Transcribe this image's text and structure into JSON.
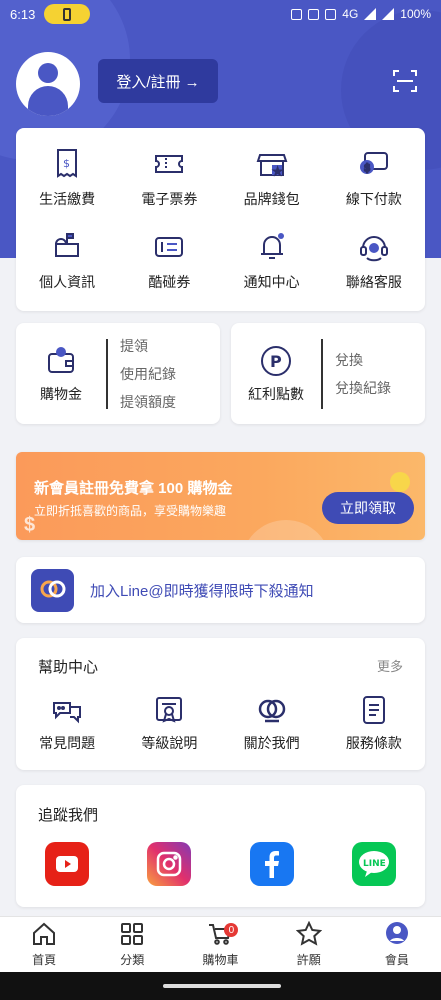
{
  "status": {
    "time": "6:13",
    "network": "4G",
    "battery": "100%"
  },
  "header": {
    "login_label": "登入/註冊 →"
  },
  "services": [
    {
      "label": "生活繳費",
      "icon": "bill-receipt-icon"
    },
    {
      "label": "電子票券",
      "icon": "ticket-icon"
    },
    {
      "label": "品牌錢包",
      "icon": "brand-wallet-store-icon"
    },
    {
      "label": "線下付款",
      "icon": "offline-payment-icon"
    },
    {
      "label": "個人資訊",
      "icon": "mailbox-icon"
    },
    {
      "label": "酷碰券",
      "icon": "coupon-icon"
    },
    {
      "label": "通知中心",
      "icon": "bell-icon"
    },
    {
      "label": "聯絡客服",
      "icon": "headset-icon"
    }
  ],
  "wallet": {
    "label": "購物金",
    "links": [
      "提領",
      "使用紀錄",
      "提領額度"
    ]
  },
  "points": {
    "label": "紅利點數",
    "links": [
      "兌換",
      "兌換紀錄"
    ]
  },
  "promo": {
    "title": "新會員註冊免費拿 100 購物金",
    "subtitle": "立即折抵喜歡的商品，享受購物樂趣",
    "button": "立即領取",
    "colors": {
      "banner": "#fba85e",
      "button": "#3f4bb5"
    }
  },
  "line_banner": {
    "text": "加入Line@即時獲得限時下殺通知"
  },
  "help": {
    "title": "幫助中心",
    "more": "更多",
    "items": [
      {
        "label": "常見問題",
        "icon": "chat-bubbles-icon"
      },
      {
        "label": "等級說明",
        "icon": "certificate-icon"
      },
      {
        "label": "關於我們",
        "icon": "brand-logo-icon"
      },
      {
        "label": "服務條款",
        "icon": "document-icon"
      }
    ]
  },
  "follow": {
    "title": "追蹤我們",
    "socials": [
      "youtube-icon",
      "instagram-icon",
      "facebook-icon",
      "line-icon"
    ],
    "line_text": "LINE"
  },
  "tabbar": {
    "items": [
      {
        "label": "首頁",
        "icon": "home-icon"
      },
      {
        "label": "分類",
        "icon": "grid-icon"
      },
      {
        "label": "購物車",
        "icon": "cart-icon",
        "badge": "0"
      },
      {
        "label": "許願",
        "icon": "star-icon"
      },
      {
        "label": "會員",
        "icon": "member-icon",
        "active": true
      }
    ]
  },
  "theme": {
    "primary": "#4a57c4",
    "dark": "#2f3a9e"
  }
}
